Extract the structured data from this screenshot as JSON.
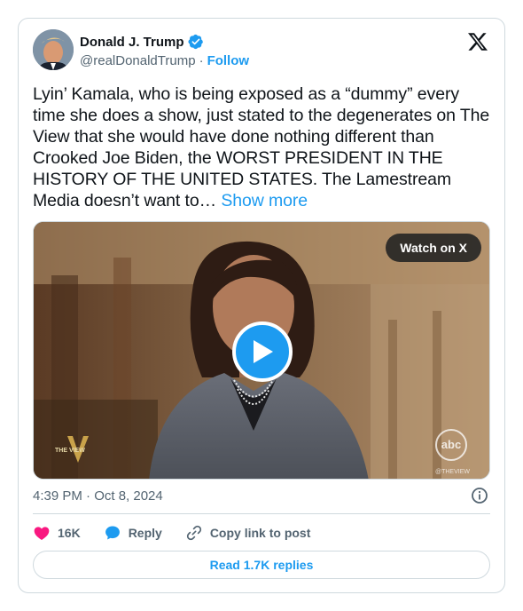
{
  "author": {
    "name": "Donald J. Trump",
    "handle": "@realDonaldTrump",
    "separator": "·",
    "follow_label": "Follow",
    "verified_color": "#1d9bf0"
  },
  "tweet": {
    "text": "Lyin’ Kamala, who is being exposed as a “dummy” every time she does a show, just stated to the degenerates on The View that she would have done nothing different than Crooked Joe Biden, the WORST PRESIDENT IN THE HISTORY OF THE UNITED STATES. The Lamestream Media doesn’t want to… ",
    "show_more_label": "Show more",
    "timestamp": "4:39 PM · Oct 8, 2024"
  },
  "media": {
    "watch_label": "Watch on X",
    "network_logo": "abc",
    "network_tag": "@THEVIEW",
    "show_logo_text": "THE VIEW"
  },
  "actions": {
    "like_count": "16K",
    "reply_label": "Reply",
    "copy_label": "Copy link to post"
  },
  "read_replies_label": "Read 1.7K replies",
  "colors": {
    "accent": "#1d9bf0",
    "like": "#f91880",
    "text": "#0f1419",
    "muted": "#536471",
    "border": "#cfd9de"
  }
}
